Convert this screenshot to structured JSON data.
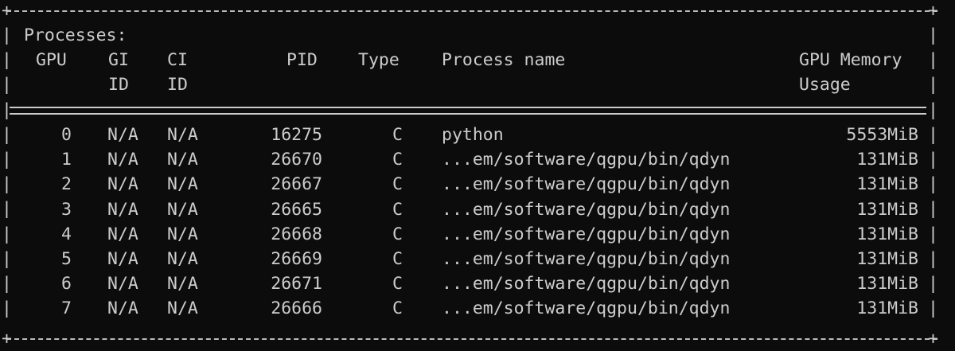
{
  "panel": {
    "title": "Processes:",
    "headers": {
      "gpu": "GPU",
      "gi": "GI",
      "gi2": "ID",
      "ci": "CI",
      "ci2": "ID",
      "pid": "PID",
      "type": "Type",
      "name": "Process name",
      "mem": "GPU Memory",
      "mem2": "Usage"
    },
    "rows": [
      {
        "gpu": "0",
        "gi": "N/A",
        "ci": "N/A",
        "pid": "16275",
        "type": "C",
        "name": "python",
        "mem": "5553MiB"
      },
      {
        "gpu": "1",
        "gi": "N/A",
        "ci": "N/A",
        "pid": "26670",
        "type": "C",
        "name": "...em/software/qgpu/bin/qdyn",
        "mem": "131MiB"
      },
      {
        "gpu": "2",
        "gi": "N/A",
        "ci": "N/A",
        "pid": "26667",
        "type": "C",
        "name": "...em/software/qgpu/bin/qdyn",
        "mem": "131MiB"
      },
      {
        "gpu": "3",
        "gi": "N/A",
        "ci": "N/A",
        "pid": "26665",
        "type": "C",
        "name": "...em/software/qgpu/bin/qdyn",
        "mem": "131MiB"
      },
      {
        "gpu": "4",
        "gi": "N/A",
        "ci": "N/A",
        "pid": "26668",
        "type": "C",
        "name": "...em/software/qgpu/bin/qdyn",
        "mem": "131MiB"
      },
      {
        "gpu": "5",
        "gi": "N/A",
        "ci": "N/A",
        "pid": "26669",
        "type": "C",
        "name": "...em/software/qgpu/bin/qdyn",
        "mem": "131MiB"
      },
      {
        "gpu": "6",
        "gi": "N/A",
        "ci": "N/A",
        "pid": "26671",
        "type": "C",
        "name": "...em/software/qgpu/bin/qdyn",
        "mem": "131MiB"
      },
      {
        "gpu": "7",
        "gi": "N/A",
        "ci": "N/A",
        "pid": "26666",
        "type": "C",
        "name": "...em/software/qgpu/bin/qdyn",
        "mem": "131MiB"
      }
    ]
  },
  "colors": {
    "background": "#0c0c0c",
    "text": "#cccccc"
  }
}
